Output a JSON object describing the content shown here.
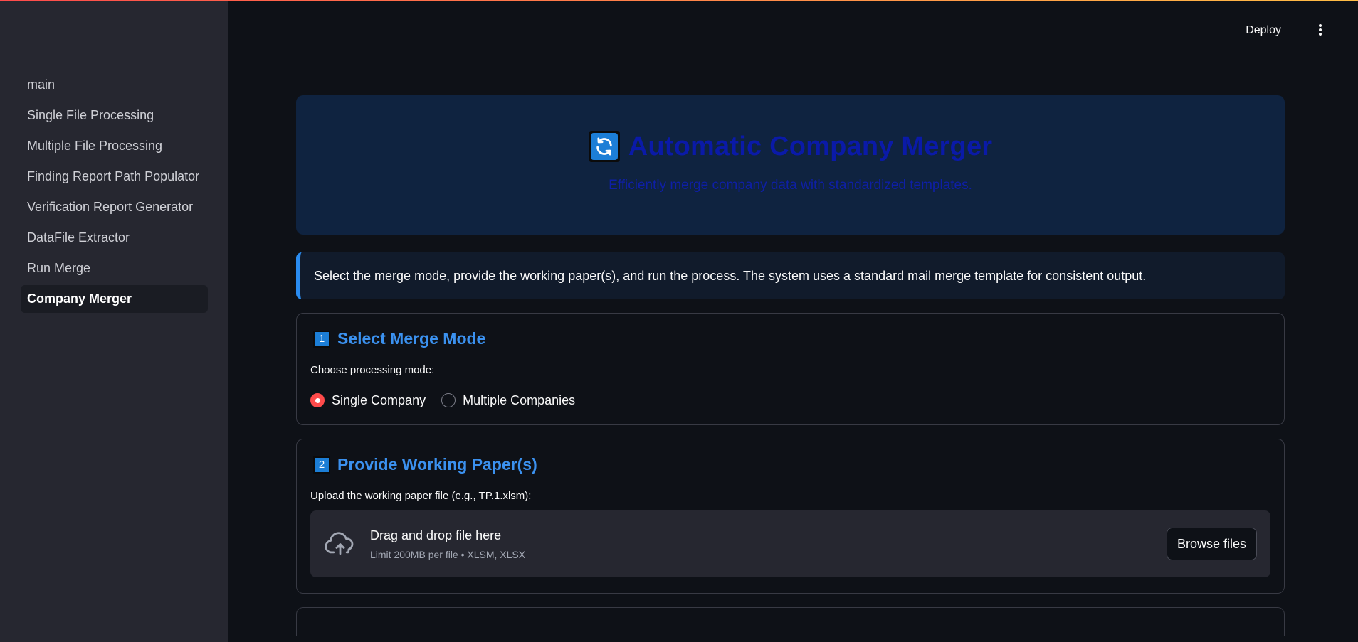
{
  "header": {
    "deploy_label": "Deploy"
  },
  "sidebar": {
    "items": [
      {
        "label": "main"
      },
      {
        "label": "Single File Processing"
      },
      {
        "label": "Multiple File Processing"
      },
      {
        "label": "Finding Report Path Populator"
      },
      {
        "label": "Verification Report Generator"
      },
      {
        "label": "DataFile Extractor"
      },
      {
        "label": "Run Merge"
      },
      {
        "label": "Company Merger",
        "active": true
      }
    ]
  },
  "hero": {
    "icon": "refresh-icon",
    "title": "Automatic Company Merger",
    "subtitle": "Efficiently merge company data with standardized templates."
  },
  "info": {
    "text": "Select the merge mode, provide the working paper(s), and run the process. The system uses a standard mail merge template for consistent output."
  },
  "step1": {
    "number": "1",
    "title": "Select Merge Mode",
    "label": "Choose processing mode:",
    "options": [
      {
        "label": "Single Company",
        "selected": true
      },
      {
        "label": "Multiple Companies",
        "selected": false
      }
    ]
  },
  "step2": {
    "number": "2",
    "title": "Provide Working Paper(s)",
    "label": "Upload the working paper file (e.g., TP.1.xlsm):",
    "dropzone_title": "Drag and drop file here",
    "dropzone_limit": "Limit 200MB per file • XLSM, XLSX",
    "browse_label": "Browse files",
    "icon": "cloud-upload-icon"
  },
  "colors": {
    "accent": "#ff4b4b",
    "sidebar_bg": "#262730",
    "app_bg": "#0e1117",
    "hero_bg": "#0f2340",
    "step_title": "#3b91ef",
    "info_border": "#2a8cf0"
  }
}
